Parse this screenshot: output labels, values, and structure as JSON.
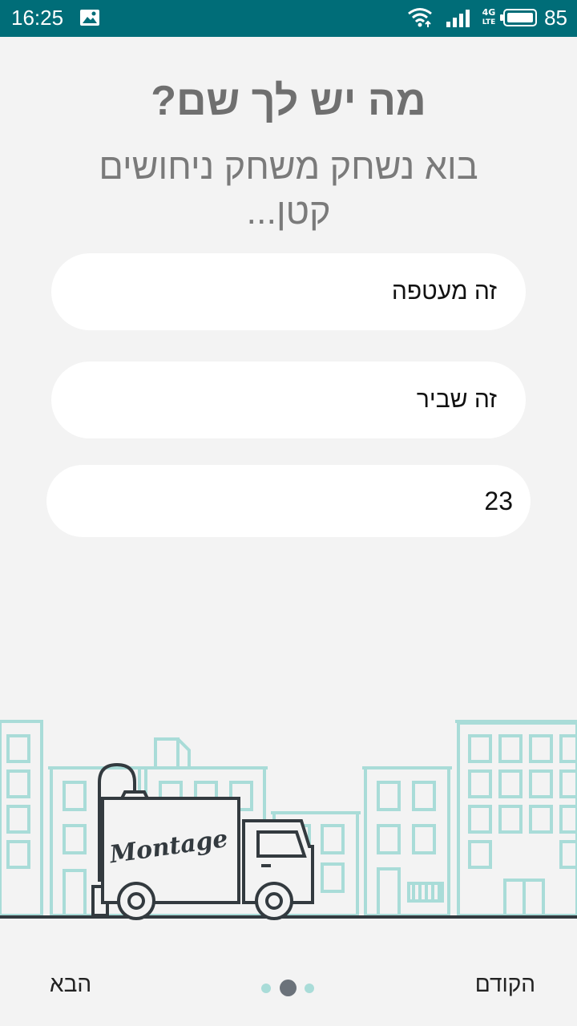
{
  "status_bar": {
    "time": "16:25",
    "network": "4G",
    "network_sub": "LTE",
    "battery": "85"
  },
  "screen": {
    "title": "מה יש לך שם?",
    "subtitle": "בוא נשחק משחק ניחושים קטן..."
  },
  "fields": [
    {
      "value": "זה מעטפה"
    },
    {
      "value": "זה שביר"
    },
    {
      "value": "23"
    }
  ],
  "illustration": {
    "brand": "Montage"
  },
  "nav": {
    "next_label": "הבא",
    "prev_label": "הקודם",
    "page_count": 3,
    "current_page": 2
  },
  "colors": {
    "status_bar": "#006d78",
    "background": "#f3f3f3",
    "building_line": "#a9dcd8",
    "truck_line": "#333a3f",
    "dot_active": "#6b727a",
    "dot_inactive": "#a9dcd8"
  }
}
